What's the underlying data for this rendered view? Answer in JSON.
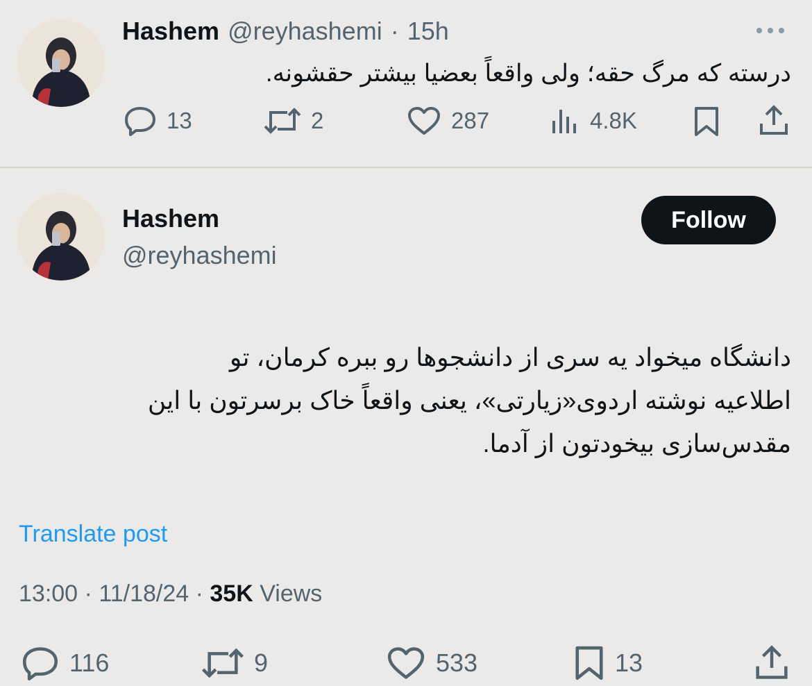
{
  "tweet1": {
    "name": "Hashem",
    "handle": "@reyhashemi",
    "separator": "·",
    "time": "15h",
    "text": "درسته که مرگ حقه؛ ولی واقعاً بعضیا بیشتر حقشونه.",
    "stats": {
      "replies": "13",
      "reposts": "2",
      "likes": "287",
      "views": "4.8K"
    }
  },
  "tweet2": {
    "name": "Hashem",
    "handle": "@reyhashemi",
    "follow_label": "Follow",
    "text_lines": [
      "دانشگاه میخواد یه سری از دانشجوها رو ببره کرمان، تو",
      "اطلاعیه نوشته اردوی«زیارتی»، یعنی واقعاً خاک برسرتون با این",
      "مقدس‌سازی بیخودتون از آدما."
    ],
    "translate_label": "Translate post",
    "meta": {
      "time": "13:00",
      "date": "11/18/24",
      "views_count": "35K",
      "views_label": "Views",
      "separator": "·"
    },
    "stats": {
      "replies": "116",
      "reposts": "9",
      "likes": "533",
      "bookmarks": "13"
    }
  },
  "colors": {
    "background": "#ebeae8",
    "text": "#0f1419",
    "secondary": "#536471",
    "link": "#1d9bf0",
    "button": "#0f1419"
  }
}
